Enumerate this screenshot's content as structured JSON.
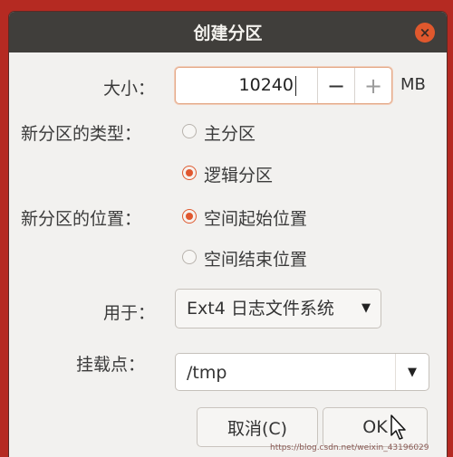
{
  "window": {
    "title": "创建分区",
    "close_label": "×"
  },
  "size": {
    "label": "大小：",
    "value": "10240",
    "minus": "−",
    "plus": "+",
    "unit": "MB"
  },
  "type": {
    "label": "新分区的类型：",
    "options": [
      {
        "label": "主分区",
        "selected": false
      },
      {
        "label": "逻辑分区",
        "selected": true
      }
    ]
  },
  "location": {
    "label": "新分区的位置：",
    "options": [
      {
        "label": "空间起始位置",
        "selected": true
      },
      {
        "label": "空间结束位置",
        "selected": false
      }
    ]
  },
  "use_as": {
    "label": "用于：",
    "value": "Ext4 日志文件系统",
    "arrow": "▼"
  },
  "mount": {
    "label": "挂载点：",
    "value": "/tmp",
    "arrow": "▼"
  },
  "buttons": {
    "cancel": "取消(C)",
    "ok": "OK"
  },
  "colors": {
    "accent": "#e0572f",
    "titlebar": "#403e3b",
    "background": "#b52a22"
  },
  "watermark": "https://blog.csdn.net/weixin_43196029"
}
